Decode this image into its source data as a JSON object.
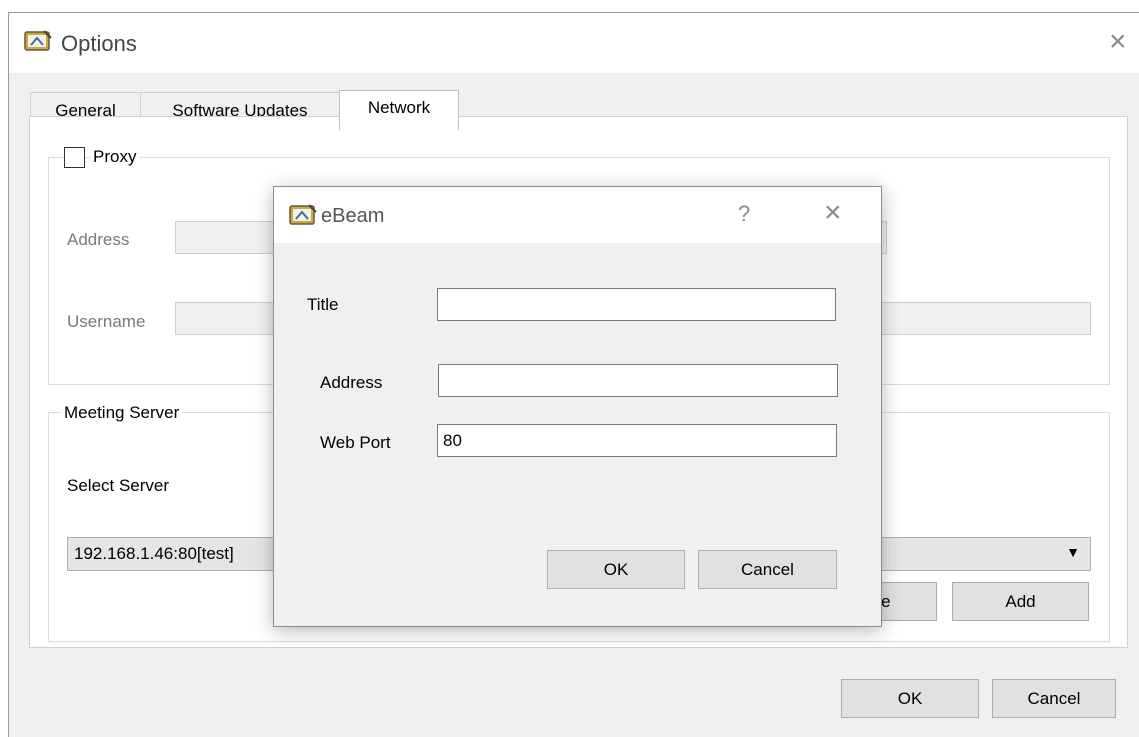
{
  "options": {
    "title": "Options",
    "tabs": [
      {
        "label": "General"
      },
      {
        "label": "Software Updates"
      },
      {
        "label": "Network"
      }
    ],
    "proxy": {
      "label": "Proxy",
      "checked": false,
      "address_label": "Address",
      "address_value": "",
      "username_label": "Username",
      "username_value": ""
    },
    "meeting_server": {
      "label": "Meeting Server",
      "select_label": "Select Server",
      "selected": "192.168.1.46:80[test]",
      "delete_label": "te",
      "add_label": "Add"
    },
    "ok_label": "OK",
    "cancel_label": "Cancel"
  },
  "dialog": {
    "title": "eBeam",
    "help": "?",
    "close": "×",
    "title_label": "Title",
    "title_value": "",
    "address_label": "Address",
    "address_value": "",
    "port_label": "Web Port",
    "port_value": "80",
    "ok_label": "OK",
    "cancel_label": "Cancel"
  },
  "icons": {
    "app": "ebeam-app-icon",
    "close": "close-icon",
    "help": "help-icon",
    "dropdown": "dropdown-arrow-icon"
  },
  "colors": {
    "window_bg": "#f0f0f0",
    "button_bg": "#e1e1e1",
    "disabled_field": "#f0f0f0"
  }
}
